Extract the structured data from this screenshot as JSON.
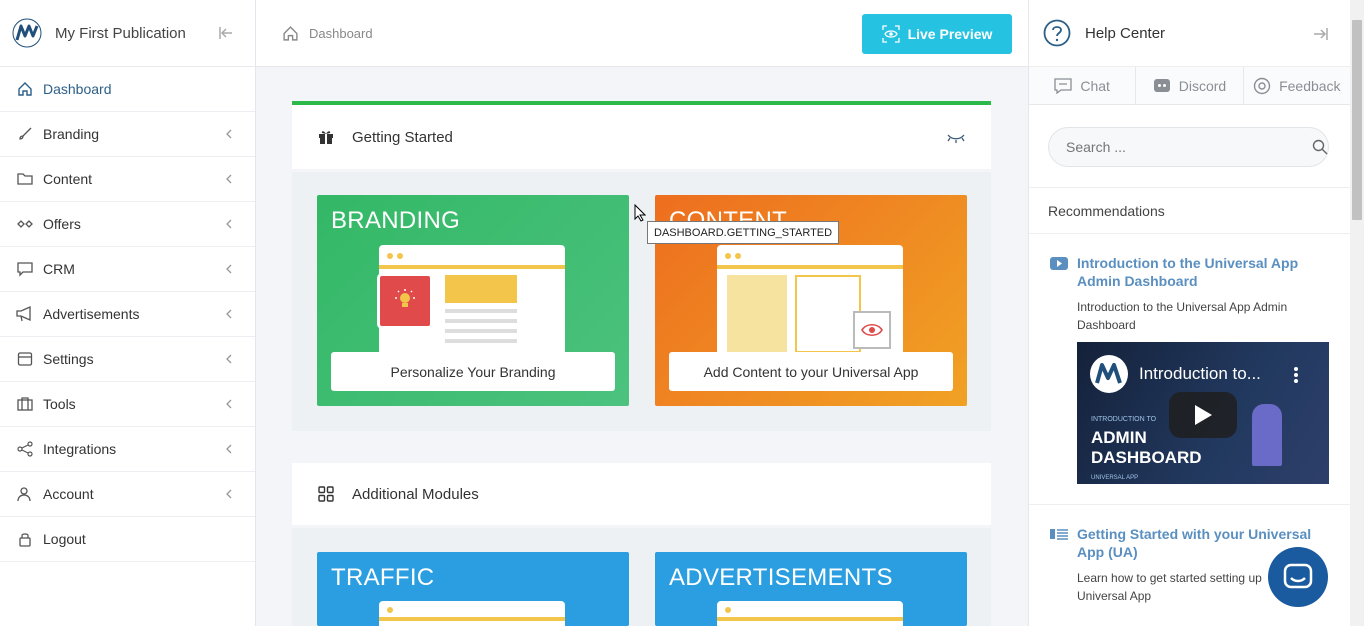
{
  "sidebar": {
    "publication_title": "My First Publication",
    "items": [
      {
        "label": "Dashboard",
        "icon": "home-icon",
        "active": true
      },
      {
        "label": "Branding",
        "icon": "brush-icon"
      },
      {
        "label": "Content",
        "icon": "folder-icon"
      },
      {
        "label": "Offers",
        "icon": "offers-icon"
      },
      {
        "label": "CRM",
        "icon": "chat-icon"
      },
      {
        "label": "Advertisements",
        "icon": "megaphone-icon"
      },
      {
        "label": "Settings",
        "icon": "settings-icon"
      },
      {
        "label": "Tools",
        "icon": "toolbox-icon"
      },
      {
        "label": "Integrations",
        "icon": "share-icon"
      },
      {
        "label": "Account",
        "icon": "user-icon"
      },
      {
        "label": "Logout",
        "icon": "lock-icon"
      }
    ]
  },
  "topbar": {
    "breadcrumb": "Dashboard",
    "live_preview_label": "Live Preview"
  },
  "getting_started": {
    "title": "Getting Started",
    "tooltip": "DASHBOARD.GETTING_STARTED",
    "cards": [
      {
        "title": "BRANDING",
        "button": "Personalize Your Branding",
        "color": "#3fb86a"
      },
      {
        "title": "CONTENT",
        "button": "Add Content to your Universal App",
        "color": "#ee7a1c"
      }
    ]
  },
  "additional_modules": {
    "title": "Additional Modules",
    "cards": [
      {
        "title": "TRAFFIC",
        "color": "#2a9ee0"
      },
      {
        "title": "ADVERTISEMENTS",
        "color": "#2a9ee0"
      }
    ]
  },
  "help": {
    "title": "Help Center",
    "tabs": [
      {
        "label": "Chat",
        "icon": "chat-icon"
      },
      {
        "label": "Discord",
        "icon": "discord-icon"
      },
      {
        "label": "Feedback",
        "icon": "feedback-icon"
      }
    ],
    "search_placeholder": "Search ...",
    "recommendations_title": "Recommendations",
    "recommendations": [
      {
        "title_line1": "Introduction to the Universal App",
        "title_line2": "Admin Dashboard",
        "desc_line1": "Introduction to the Universal App Admin",
        "desc_line2": "Dashboard",
        "icon": "youtube-icon",
        "video": {
          "title": "Introduction to...",
          "small": "INTRODUCTION TO",
          "big_line1": "ADMIN",
          "big_line2": "DASHBOARD",
          "caption": "UNIVERSAL APP"
        }
      },
      {
        "title_line1": "Getting Started with your Universal",
        "title_line2": "App (UA)",
        "desc_line1": "Learn how to get started setting up",
        "desc_line2": "Universal App",
        "icon": "article-icon"
      }
    ]
  },
  "colors": {
    "accent": "#25c3e1",
    "progress": "#2db84a",
    "link": "#5a8fc0",
    "chat_bubble": "#1a5a9e"
  }
}
